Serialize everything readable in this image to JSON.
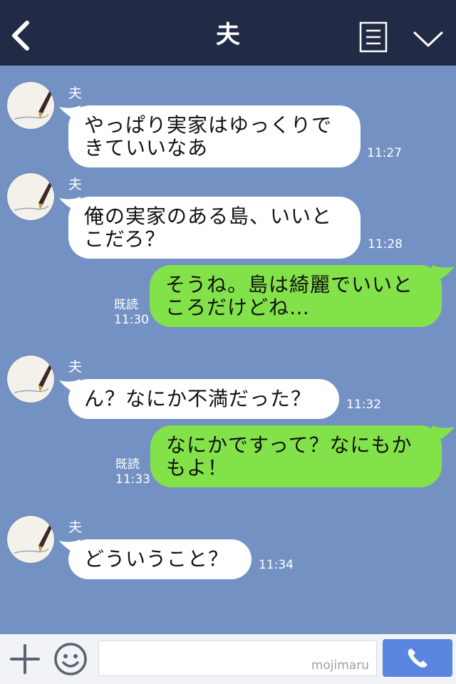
{
  "header": {
    "title": "夫",
    "back_icon": "chevron-left-icon",
    "menu_icon": "list-icon",
    "dropdown_icon": "chevron-down-icon"
  },
  "messages": [
    {
      "side": "in",
      "sender": "夫",
      "lines": [
        "やっぱり実家はゆっくりで",
        "きていいなあ"
      ],
      "time": "11:27"
    },
    {
      "side": "in",
      "sender": "夫",
      "lines": [
        "俺の実家のある島、いいと",
        "こだろ？"
      ],
      "time": "11:28"
    },
    {
      "side": "out",
      "lines": [
        "そうね。島は綺麗でいいと",
        "ころだけどね…"
      ],
      "read": "既読",
      "time": "11:30"
    },
    {
      "side": "in",
      "sender": "夫",
      "lines": [
        "ん？なにか不満だった？"
      ],
      "time": "11:32"
    },
    {
      "side": "out",
      "lines": [
        "なにかですって？なにもか",
        "もよ！"
      ],
      "read": "既読",
      "time": "11:33"
    },
    {
      "side": "in",
      "sender": "夫",
      "lines": [
        "どういうこと？"
      ],
      "time": "11:34"
    }
  ],
  "footer": {
    "input_value": "",
    "watermark": "mojimaru",
    "plus_icon": "plus-icon",
    "emoji_icon": "smiley-icon",
    "call_icon": "phone-icon"
  },
  "colors": {
    "background": "#7391c2",
    "header": "#222b45",
    "outgoing_bubble": "#83e24a",
    "incoming_bubble": "#ffffff",
    "call_button": "#5b86df"
  }
}
